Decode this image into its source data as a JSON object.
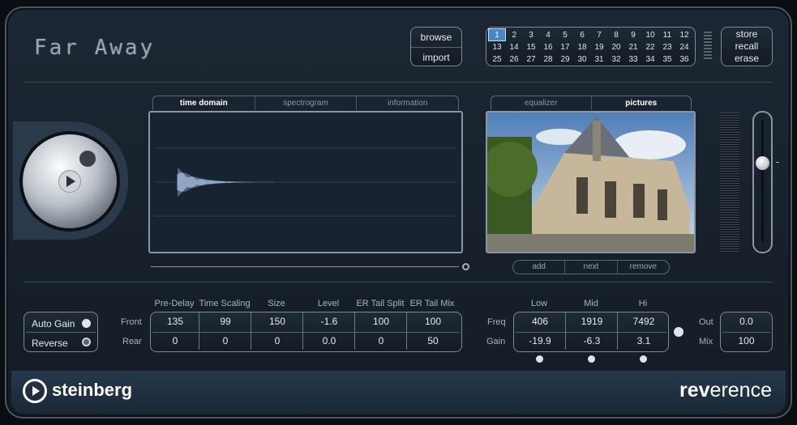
{
  "preset_name": "Far Away",
  "browse": "browse",
  "import": "import",
  "store": "store",
  "recall": "recall",
  "erase": "erase",
  "slots": [
    "1",
    "2",
    "3",
    "4",
    "5",
    "6",
    "7",
    "8",
    "9",
    "10",
    "11",
    "12",
    "13",
    "14",
    "15",
    "16",
    "17",
    "18",
    "19",
    "20",
    "21",
    "22",
    "23",
    "24",
    "25",
    "26",
    "27",
    "28",
    "29",
    "30",
    "31",
    "32",
    "33",
    "34",
    "35",
    "36"
  ],
  "selected_slot": "1",
  "left_tabs": [
    "time domain",
    "spectrogram",
    "information"
  ],
  "right_tabs": [
    "equalizer",
    "pictures"
  ],
  "pic_buttons": [
    "add",
    "next",
    "remove"
  ],
  "auto_gain": "Auto Gain",
  "reverse": "Reverse",
  "row_front": "Front",
  "row_rear": "Rear",
  "params": [
    {
      "label": "Pre-Delay",
      "front": "135",
      "rear": "0"
    },
    {
      "label": "Time Scaling",
      "front": "99",
      "rear": "0"
    },
    {
      "label": "Size",
      "front": "150",
      "rear": "0"
    },
    {
      "label": "Level",
      "front": "-1.6",
      "rear": "0.0"
    },
    {
      "label": "ER Tail Split",
      "front": "100",
      "rear": "0"
    },
    {
      "label": "ER Tail Mix",
      "front": "100",
      "rear": "50"
    }
  ],
  "eq_freq_label": "Freq",
  "eq_gain_label": "Gain",
  "eq": [
    {
      "label": "Low",
      "freq": "406",
      "gain": "-19.9"
    },
    {
      "label": "Mid",
      "freq": "1919",
      "gain": "-6.3"
    },
    {
      "label": "Hi",
      "freq": "7492",
      "gain": "3.1"
    }
  ],
  "out_label": "Out",
  "out_value": "0.0",
  "mix_label": "Mix",
  "mix_value": "100",
  "brand": "steinberg",
  "product_bold": "rev",
  "product_rest": "erence"
}
